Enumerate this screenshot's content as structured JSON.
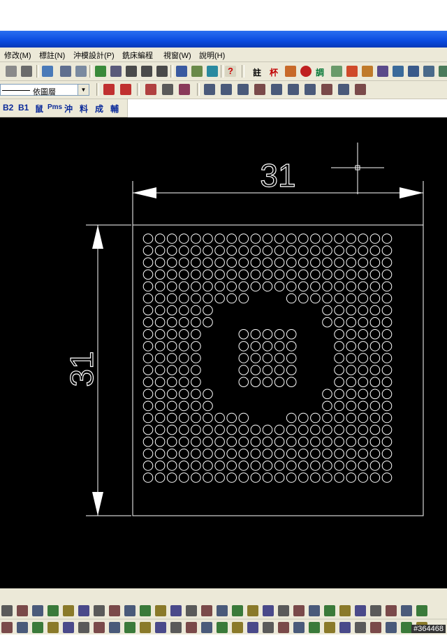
{
  "menu": [
    {
      "label": "修改(M)"
    },
    {
      "label": "標註(N)"
    },
    {
      "label": "沖模設計(P)"
    },
    {
      "label": "銑床編程"
    },
    {
      "label": "視窗(W)"
    },
    {
      "label": "說明(H)"
    }
  ],
  "layer_combo": {
    "value": "依圖層"
  },
  "toolbar3_labels": [
    {
      "label": "B2"
    },
    {
      "label": "B1"
    },
    {
      "label": "鼠"
    },
    {
      "label": "Pms"
    },
    {
      "label": "沖"
    },
    {
      "label": "料"
    },
    {
      "label": "成"
    },
    {
      "label": "輔"
    }
  ],
  "toolbar1_text_labels": [
    {
      "label": "註"
    },
    {
      "label": "杯"
    },
    {
      "label": "調"
    }
  ],
  "drawing": {
    "horizontal_dimension": "31",
    "vertical_dimension": "31",
    "hole_grid": "21 x 21 with central keep-out and inner 5 x 5 cluster"
  },
  "watermark": "#364468",
  "colors": {
    "canvas": "#000000",
    "geometry": "#ffffff",
    "toolbar": "#ece9d8",
    "titlebar": "#0a4be0"
  }
}
